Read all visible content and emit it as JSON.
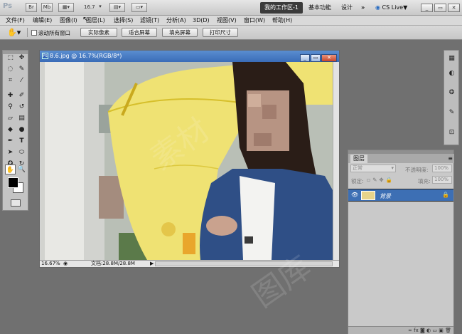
{
  "app": {
    "logo": "Ps",
    "mode_br": "Br",
    "mode_mb": "Mb",
    "zoom": "16.7",
    "workspaces": [
      "我的工作区-1",
      "基本功能",
      "设计"
    ],
    "more": "»",
    "cs_live": "CS Live▼"
  },
  "menu": {
    "items": [
      "文件(F)",
      "编辑(E)",
      "图像(I)",
      "图层(L)",
      "选择(S)",
      "滤镜(T)",
      "分析(A)",
      "3D(D)",
      "视图(V)",
      "窗口(W)",
      "帮助(H)"
    ]
  },
  "options": {
    "scroll_all_label": "滚动所有窗口",
    "scroll_all_checked": false,
    "buttons": [
      "实际像素",
      "适合屏幕",
      "填充屏幕",
      "打印尺寸"
    ]
  },
  "document": {
    "title": "8.6.jpg @ 16.7%(RGB/8*)",
    "zoom_status": "16.67%",
    "doc_size": "文档:28.8M/28.8M"
  },
  "layers_panel": {
    "tab_label": "图层",
    "blend_mode": "正常",
    "opacity_label": "不透明度:",
    "opacity_value": "100%",
    "lock_label": "锁定:",
    "fill_label": "填充:",
    "fill_value": "100%",
    "layers": [
      {
        "name": "背景",
        "locked": true,
        "visible": true
      }
    ]
  },
  "colors": {
    "foreground": "#000000",
    "background": "#ffffff",
    "selection": "#3d6fb4",
    "umbrella": "#f0e36a"
  },
  "icons": [
    "hand-tool-icon",
    "eye-icon",
    "lock-icon",
    "move-tool-icon",
    "marquee-tool-icon",
    "lasso-tool-icon",
    "crop-tool-icon",
    "brush-tool-icon",
    "type-tool-icon",
    "zoom-tool-icon"
  ]
}
